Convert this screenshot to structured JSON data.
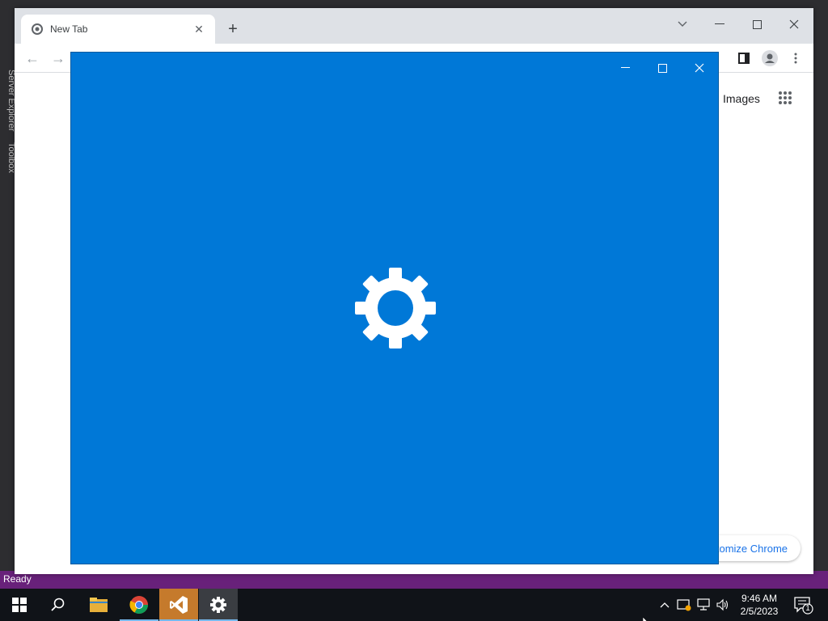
{
  "chrome": {
    "tab_title": "New Tab",
    "images_link": "Images",
    "customize_label": "tomize Chrome"
  },
  "vs": {
    "side_server_explorer": "Server Explorer",
    "side_toolbox": "Toolbox",
    "status_text": "Ready"
  },
  "settings_window": {
    "bg_color": "#0078d7",
    "icon": "gear-icon"
  },
  "taskbar": {
    "apps": [
      "start",
      "search",
      "file-explorer",
      "chrome",
      "visual-studio",
      "settings"
    ],
    "time": "9:46 AM",
    "date": "2/5/2023",
    "notification_count": "1"
  }
}
